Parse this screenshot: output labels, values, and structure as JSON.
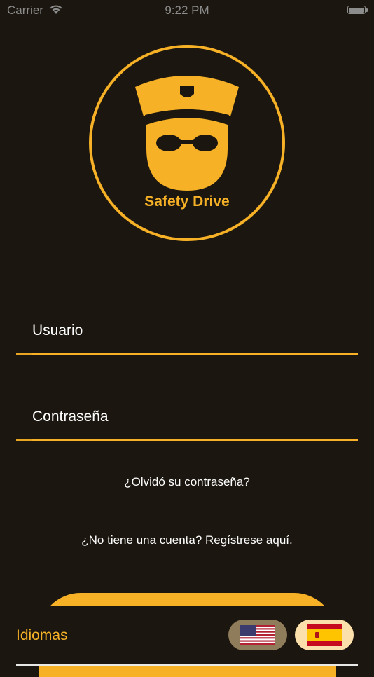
{
  "status_bar": {
    "carrier": "Carrier",
    "time": "9:22 PM"
  },
  "logo": {
    "text": "Safety Drive",
    "icon": "police-officer-icon"
  },
  "form": {
    "username_label": "Usuario",
    "password_label": "Contraseña"
  },
  "links": {
    "forgot_password": "¿Olvidó su contraseña?",
    "register": "¿No tiene una cuenta? Regístrese aquí."
  },
  "language_bar": {
    "label": "Idiomas",
    "options": [
      {
        "icon": "us-flag-icon",
        "selected": false
      },
      {
        "icon": "spain-flag-icon",
        "selected": true
      }
    ]
  },
  "colors": {
    "background": "#1b160f",
    "accent": "#f6b127",
    "text": "#ffffff"
  }
}
